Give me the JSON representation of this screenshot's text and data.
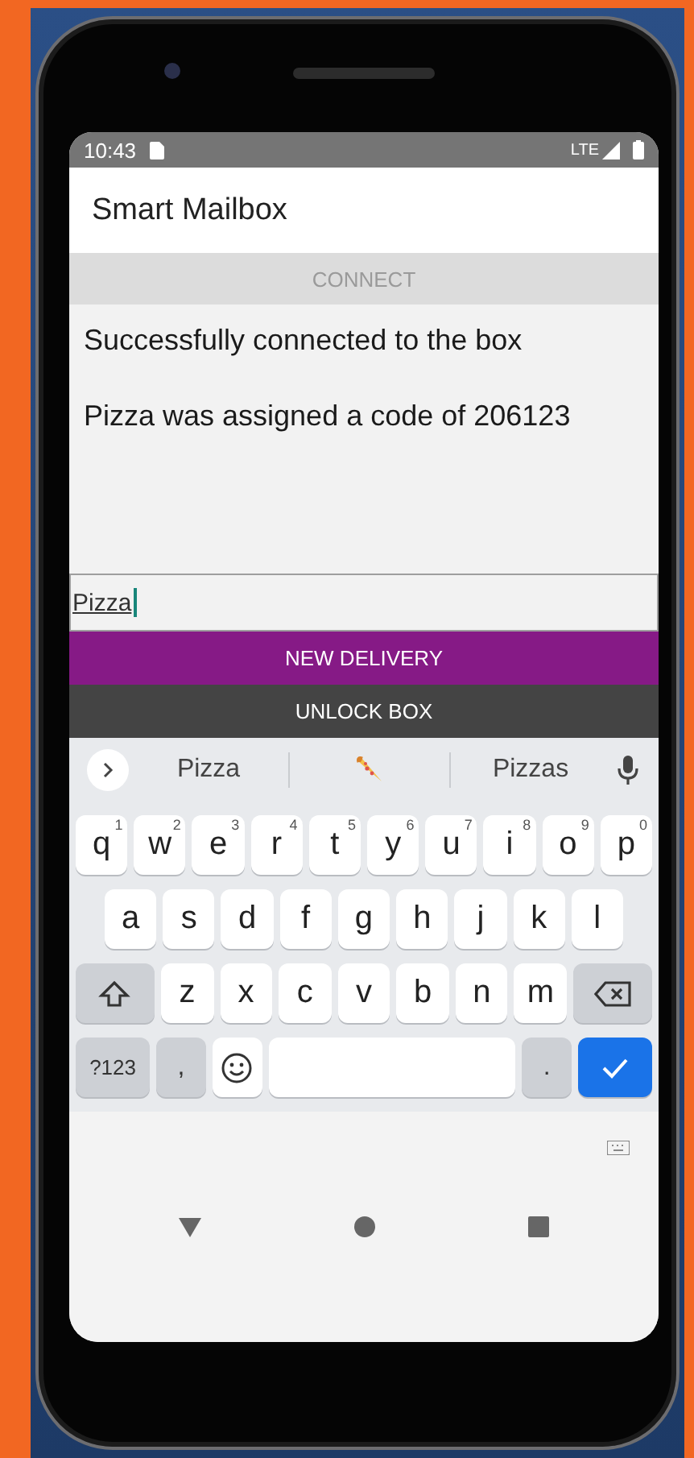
{
  "status_bar": {
    "time": "10:43",
    "network": "LTE"
  },
  "app_bar": {
    "title": "Smart Mailbox"
  },
  "connect_button": {
    "label": "CONNECT",
    "disabled": true
  },
  "messages": [
    "Successfully connected to the box",
    "Pizza was assigned a code of 206123"
  ],
  "input": {
    "value": "Pizza"
  },
  "buttons": [
    {
      "label": "NEW DELIVERY",
      "kind": "primary"
    },
    {
      "label": "UNLOCK BOX",
      "kind": "dark"
    }
  ],
  "keyboard": {
    "suggestions": [
      {
        "kind": "word",
        "text": "Pizza"
      },
      {
        "kind": "emoji"
      },
      {
        "kind": "word",
        "text": "Pizzas"
      }
    ],
    "rows": [
      [
        {
          "kind": "letter",
          "label": "q",
          "hint": "1"
        },
        {
          "kind": "letter",
          "label": "w",
          "hint": "2"
        },
        {
          "kind": "letter",
          "label": "e",
          "hint": "3"
        },
        {
          "kind": "letter",
          "label": "r",
          "hint": "4"
        },
        {
          "kind": "letter",
          "label": "t",
          "hint": "5"
        },
        {
          "kind": "letter",
          "label": "y",
          "hint": "6"
        },
        {
          "kind": "letter",
          "label": "u",
          "hint": "7"
        },
        {
          "kind": "letter",
          "label": "i",
          "hint": "8"
        },
        {
          "kind": "letter",
          "label": "o",
          "hint": "9"
        },
        {
          "kind": "letter",
          "label": "p",
          "hint": "0"
        }
      ],
      [
        {
          "kind": "letter",
          "label": "a"
        },
        {
          "kind": "letter",
          "label": "s"
        },
        {
          "kind": "letter",
          "label": "d"
        },
        {
          "kind": "letter",
          "label": "f"
        },
        {
          "kind": "letter",
          "label": "g"
        },
        {
          "kind": "letter",
          "label": "h"
        },
        {
          "kind": "letter",
          "label": "j"
        },
        {
          "kind": "letter",
          "label": "k"
        },
        {
          "kind": "letter",
          "label": "l"
        }
      ],
      [
        {
          "kind": "shift"
        },
        {
          "kind": "letter",
          "label": "z"
        },
        {
          "kind": "letter",
          "label": "x"
        },
        {
          "kind": "letter",
          "label": "c"
        },
        {
          "kind": "letter",
          "label": "v"
        },
        {
          "kind": "letter",
          "label": "b"
        },
        {
          "kind": "letter",
          "label": "n"
        },
        {
          "kind": "letter",
          "label": "m"
        },
        {
          "kind": "backspace"
        }
      ],
      [
        {
          "kind": "symbols",
          "label": "?123"
        },
        {
          "kind": "punct",
          "label": ","
        },
        {
          "kind": "emoji"
        },
        {
          "kind": "space"
        },
        {
          "kind": "punct",
          "label": "."
        },
        {
          "kind": "enter"
        }
      ]
    ]
  }
}
